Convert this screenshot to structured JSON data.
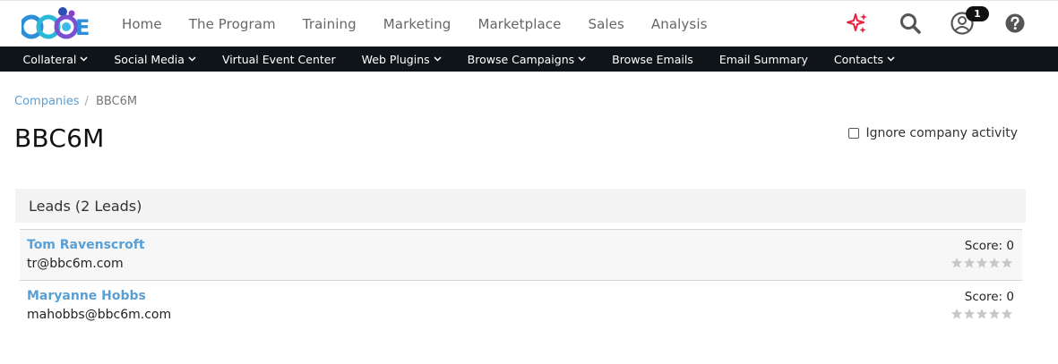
{
  "logo_alt": "CCOE",
  "main_nav": [
    {
      "label": "Home"
    },
    {
      "label": "The Program"
    },
    {
      "label": "Training"
    },
    {
      "label": "Marketing"
    },
    {
      "label": "Marketplace"
    },
    {
      "label": "Sales"
    },
    {
      "label": "Analysis"
    }
  ],
  "notifications": {
    "count": "1"
  },
  "icons": [
    "sparkle-icon",
    "search-icon",
    "user-icon",
    "help-icon"
  ],
  "sub_nav": [
    {
      "label": "Collateral",
      "dropdown": true
    },
    {
      "label": "Social Media",
      "dropdown": true
    },
    {
      "label": "Virtual Event Center",
      "dropdown": false
    },
    {
      "label": "Web Plugins",
      "dropdown": true
    },
    {
      "label": "Browse Campaigns",
      "dropdown": true
    },
    {
      "label": "Browse Emails",
      "dropdown": false
    },
    {
      "label": "Email Summary",
      "dropdown": false
    },
    {
      "label": "Contacts",
      "dropdown": true
    }
  ],
  "breadcrumb": {
    "parent": "Companies",
    "separator": "/",
    "current": "BBC6M"
  },
  "page_title": "BBC6M",
  "ignore_activity": {
    "label": "Ignore company activity",
    "checked": false
  },
  "leads": {
    "header": "Leads (2 Leads)",
    "items": [
      {
        "name": "Tom Ravenscroft",
        "email": "tr@bbc6m.com",
        "score": "Score: 0",
        "rating": 0,
        "max_rating": 5
      },
      {
        "name": "Maryanne Hobbs",
        "email": "mahobbs@bbc6m.com",
        "score": "Score: 0",
        "rating": 0,
        "max_rating": 5
      }
    ]
  },
  "colors": {
    "accent": "#5a9fd4",
    "subnav_bg": "#0f1419",
    "sparkle": "#e8223c",
    "star_empty": "#c8c8c8"
  }
}
